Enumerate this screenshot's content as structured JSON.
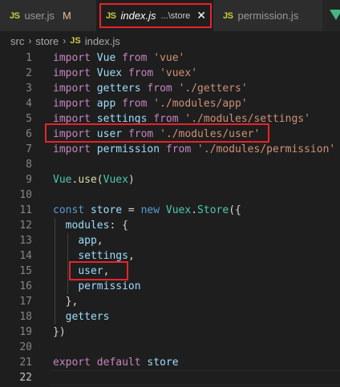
{
  "tabs": [
    {
      "icon": "JS",
      "name": "user.js",
      "status": "M"
    },
    {
      "icon": "JS",
      "name": "index.js",
      "path": "...\\store",
      "close": "✕"
    },
    {
      "icon": "JS",
      "name": "permission.js"
    }
  ],
  "breadcrumb": {
    "parts": [
      "src",
      "store",
      "index.js"
    ],
    "icon": "JS",
    "sep": "›"
  },
  "editor": {
    "current_line": 22,
    "lines": [
      {
        "n": "1",
        "tokens": [
          [
            "kw-imp",
            "import"
          ],
          [
            "pun",
            " "
          ],
          [
            "id",
            "Vue"
          ],
          [
            "pun",
            " "
          ],
          [
            "kw-imp",
            "from"
          ],
          [
            "pun",
            " "
          ],
          [
            "str",
            "'vue'"
          ]
        ]
      },
      {
        "n": "2",
        "tokens": [
          [
            "kw-imp",
            "import"
          ],
          [
            "pun",
            " "
          ],
          [
            "id",
            "Vuex"
          ],
          [
            "pun",
            " "
          ],
          [
            "kw-imp",
            "from"
          ],
          [
            "pun",
            " "
          ],
          [
            "str",
            "'vuex'"
          ]
        ]
      },
      {
        "n": "3",
        "tokens": [
          [
            "kw-imp",
            "import"
          ],
          [
            "pun",
            " "
          ],
          [
            "id",
            "getters"
          ],
          [
            "pun",
            " "
          ],
          [
            "kw-imp",
            "from"
          ],
          [
            "pun",
            " "
          ],
          [
            "str",
            "'./getters'"
          ]
        ]
      },
      {
        "n": "4",
        "tokens": [
          [
            "kw-imp",
            "import"
          ],
          [
            "pun",
            " "
          ],
          [
            "id",
            "app"
          ],
          [
            "pun",
            " "
          ],
          [
            "kw-imp",
            "from"
          ],
          [
            "pun",
            " "
          ],
          [
            "str",
            "'./modules/app'"
          ]
        ]
      },
      {
        "n": "5",
        "tokens": [
          [
            "kw-imp",
            "import"
          ],
          [
            "pun",
            " "
          ],
          [
            "id",
            "settings"
          ],
          [
            "pun",
            " "
          ],
          [
            "kw-imp",
            "from"
          ],
          [
            "pun",
            " "
          ],
          [
            "str",
            "'./modules/settings'"
          ]
        ]
      },
      {
        "n": "6",
        "tokens": [
          [
            "kw-imp",
            "import"
          ],
          [
            "pun",
            " "
          ],
          [
            "id",
            "user"
          ],
          [
            "pun",
            " "
          ],
          [
            "kw-imp",
            "from"
          ],
          [
            "pun",
            " "
          ],
          [
            "str",
            "'./modules/user'"
          ]
        ]
      },
      {
        "n": "7",
        "tokens": [
          [
            "kw-imp",
            "import"
          ],
          [
            "pun",
            " "
          ],
          [
            "id",
            "permission"
          ],
          [
            "pun",
            " "
          ],
          [
            "kw-imp",
            "from"
          ],
          [
            "pun",
            " "
          ],
          [
            "str",
            "'./modules/permission'"
          ]
        ]
      },
      {
        "n": "8",
        "tokens": []
      },
      {
        "n": "9",
        "tokens": [
          [
            "cls",
            "Vue"
          ],
          [
            "pun",
            "."
          ],
          [
            "fn",
            "use"
          ],
          [
            "pun",
            "("
          ],
          [
            "cls",
            "Vuex"
          ],
          [
            "pun",
            ")"
          ]
        ]
      },
      {
        "n": "10",
        "tokens": []
      },
      {
        "n": "11",
        "tokens": [
          [
            "kw",
            "const"
          ],
          [
            "pun",
            " "
          ],
          [
            "id",
            "store"
          ],
          [
            "pun",
            " = "
          ],
          [
            "kw",
            "new"
          ],
          [
            "pun",
            " "
          ],
          [
            "cls",
            "Vuex"
          ],
          [
            "pun",
            "."
          ],
          [
            "cls",
            "Store"
          ],
          [
            "pun",
            "({"
          ]
        ]
      },
      {
        "n": "12",
        "tokens": [
          [
            "pun",
            "  "
          ],
          [
            "id",
            "modules"
          ],
          [
            "pun",
            ": {"
          ]
        ]
      },
      {
        "n": "13",
        "tokens": [
          [
            "pun",
            "    "
          ],
          [
            "id",
            "app"
          ],
          [
            "pun",
            ","
          ]
        ]
      },
      {
        "n": "14",
        "tokens": [
          [
            "pun",
            "    "
          ],
          [
            "id",
            "settings"
          ],
          [
            "pun",
            ","
          ]
        ]
      },
      {
        "n": "15",
        "tokens": [
          [
            "pun",
            "    "
          ],
          [
            "id",
            "user"
          ],
          [
            "pun",
            ","
          ]
        ]
      },
      {
        "n": "16",
        "tokens": [
          [
            "pun",
            "    "
          ],
          [
            "id",
            "permission"
          ]
        ]
      },
      {
        "n": "17",
        "tokens": [
          [
            "pun",
            "  },"
          ]
        ]
      },
      {
        "n": "18",
        "tokens": [
          [
            "pun",
            "  "
          ],
          [
            "id",
            "getters"
          ]
        ]
      },
      {
        "n": "19",
        "tokens": [
          [
            "pun",
            "})"
          ]
        ]
      },
      {
        "n": "20",
        "tokens": []
      },
      {
        "n": "21",
        "tokens": [
          [
            "kw-imp",
            "export"
          ],
          [
            "pun",
            " "
          ],
          [
            "kw-imp",
            "default"
          ],
          [
            "pun",
            " "
          ],
          [
            "id",
            "store"
          ]
        ]
      },
      {
        "n": "22",
        "tokens": []
      }
    ]
  },
  "colors": {
    "highlight_box": "#e5242a",
    "editor_bg": "#1e1e1e",
    "tabbar_bg": "#252526"
  }
}
